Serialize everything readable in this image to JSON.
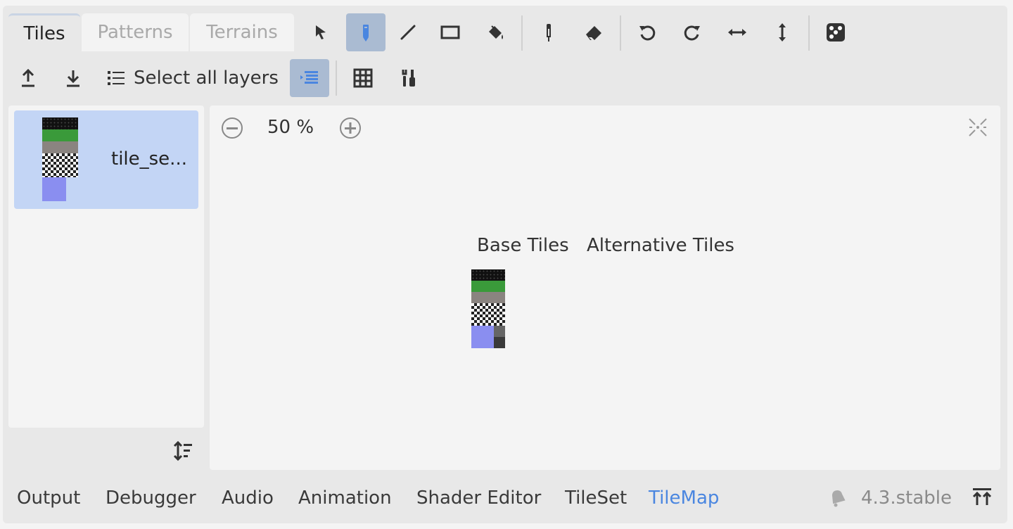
{
  "tabs": [
    {
      "label": "Tiles",
      "active": true
    },
    {
      "label": "Patterns",
      "active": false
    },
    {
      "label": "Terrains",
      "active": false
    }
  ],
  "toolbar": {
    "tools": [
      {
        "icon": "select-arrow-icon"
      },
      {
        "icon": "pencil-icon",
        "pressed": true
      },
      {
        "icon": "line-icon"
      },
      {
        "icon": "rectangle-icon"
      },
      {
        "icon": "bucket-fill-icon"
      },
      {
        "icon": "eyedropper-icon"
      },
      {
        "icon": "eraser-icon"
      },
      {
        "icon": "rotate-left-icon"
      },
      {
        "icon": "rotate-right-icon"
      },
      {
        "icon": "flip-horizontal-icon"
      },
      {
        "icon": "flip-vertical-icon"
      },
      {
        "icon": "random-dice-icon"
      }
    ],
    "select_all_layers_label": "Select all layers"
  },
  "source_list": {
    "items": [
      {
        "label": "tile_se...",
        "selected": true
      }
    ]
  },
  "atlas_view": {
    "zoom_label": "50 %",
    "base_tiles_label": "Base Tiles",
    "alternative_tiles_label": "Alternative Tiles"
  },
  "bottom_panel": {
    "items": [
      {
        "label": "Output"
      },
      {
        "label": "Debugger"
      },
      {
        "label": "Audio"
      },
      {
        "label": "Animation"
      },
      {
        "label": "Shader Editor"
      },
      {
        "label": "TileSet"
      },
      {
        "label": "TileMap",
        "active": true
      }
    ],
    "version_label": "4.3.stable"
  },
  "colors": {
    "accent": "#4a86e0",
    "selected_item_bg": "#c3d5f5",
    "pressed_button_bg": "#aabbd2",
    "grass_green": "#3a9a3a",
    "stone_gray": "#8a8480",
    "water_blue": "#8a8ef0"
  }
}
